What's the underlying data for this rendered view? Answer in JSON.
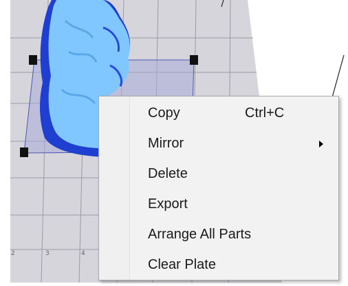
{
  "context_menu": {
    "items": [
      {
        "label": "Copy",
        "shortcut": "Ctrl+C"
      },
      {
        "label": "Mirror",
        "submenu_icon": "chevron-right-icon"
      },
      {
        "label": "Delete"
      },
      {
        "label": "Export"
      },
      {
        "label": "Arrange All Parts"
      },
      {
        "label": "Clear Plate"
      }
    ]
  },
  "viewport": {
    "ruler_ticks": [
      "2",
      "3",
      "4"
    ],
    "colors": {
      "grid_plane": "#d5d5db",
      "grid_lines": "#9a9aa4",
      "model": "#7fc4ff",
      "model_shadow": "#1933cc",
      "selection_box": "#6f79c8",
      "selection_handles": "#111111"
    }
  }
}
